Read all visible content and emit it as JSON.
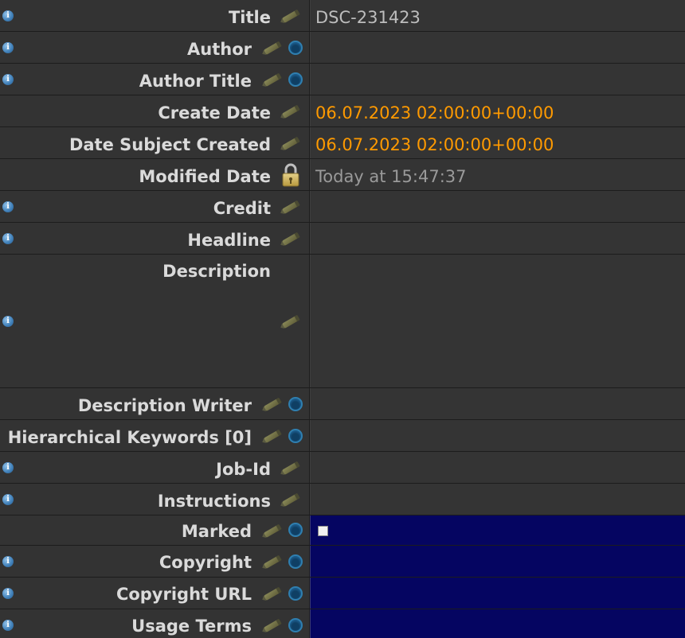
{
  "fields": {
    "title": {
      "label": "Title",
      "value": "DSC-231423"
    },
    "author": {
      "label": "Author",
      "value": ""
    },
    "author_title": {
      "label": "Author Title",
      "value": ""
    },
    "create_date": {
      "label": "Create Date",
      "value": "06.07.2023 02:00:00+00:00"
    },
    "date_subject_created": {
      "label": "Date Subject Created",
      "value": "06.07.2023 02:00:00+00:00"
    },
    "modified_date": {
      "label": "Modified Date",
      "value": "Today at 15:47:37"
    },
    "credit": {
      "label": "Credit",
      "value": ""
    },
    "headline": {
      "label": "Headline",
      "value": ""
    },
    "description": {
      "label": "Description",
      "value": ""
    },
    "description_writer": {
      "label": "Description Writer",
      "value": ""
    },
    "hierarchical_keywords": {
      "label": "Hierarchical Keywords [0]",
      "value": ""
    },
    "job_id": {
      "label": "Job-Id",
      "value": ""
    },
    "instructions": {
      "label": "Instructions",
      "value": ""
    },
    "marked": {
      "label": "Marked",
      "checked": false
    },
    "copyright": {
      "label": "Copyright",
      "value": ""
    },
    "copyright_url": {
      "label": "Copyright URL",
      "value": ""
    },
    "usage_terms": {
      "label": "Usage Terms",
      "value": ""
    }
  },
  "icons": {
    "info": "info-icon",
    "edit": "pencil-icon",
    "sync": "drop-icon",
    "locked": "lock-icon"
  },
  "colors": {
    "date_value": "#ff9a00",
    "marked_field_bg": "#050561",
    "info_icon": "#3f7fb8"
  }
}
